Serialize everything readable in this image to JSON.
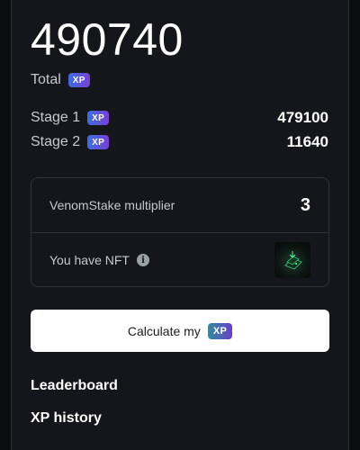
{
  "summary": {
    "total_value": "490740",
    "total_label": "Total",
    "xp_badge": "XP"
  },
  "stages": [
    {
      "label": "Stage 1",
      "badge": "XP",
      "value": "479100"
    },
    {
      "label": "Stage 2",
      "badge": "XP",
      "value": "11640"
    }
  ],
  "card": {
    "multiplier_label": "VenomStake multiplier",
    "multiplier_value": "3",
    "nft_label": "You have NFT",
    "info_icon": "i"
  },
  "calculate": {
    "label": "Calculate my",
    "badge": "XP"
  },
  "links": {
    "leaderboard": "Leaderboard",
    "xp_history": "XP history"
  },
  "colors": {
    "background": "#15161b",
    "badge_gradient_start": "#3a6fe0",
    "badge_gradient_end": "#7a3fd6",
    "button_bg": "#ffffff"
  },
  "icons": {
    "info": "info-icon",
    "nft": "nft-thumbnail"
  }
}
